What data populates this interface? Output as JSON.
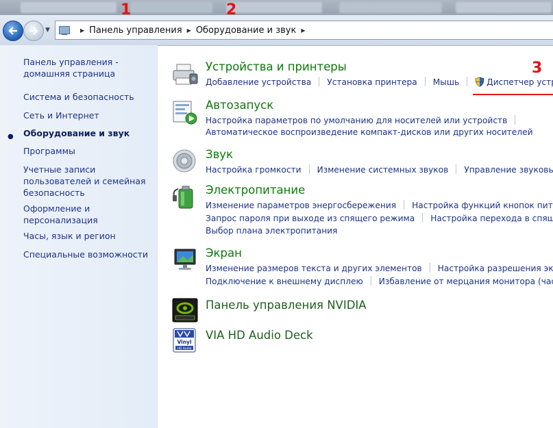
{
  "annotations": [
    "1",
    "2",
    "3"
  ],
  "address_bar": {
    "crumbs": [
      "Панель управления",
      "Оборудование и звук"
    ]
  },
  "sidebar": {
    "home": "Панель управления - домашняя страница",
    "items": [
      "Система и безопасность",
      "Сеть и Интернет",
      "Оборудование и звук",
      "Программы",
      "Учетные записи пользователей и семейная безопасность",
      "Оформление и персонализация",
      "Часы, язык и регион",
      "Специальные возможности"
    ],
    "active_index": 2
  },
  "categories": {
    "devices": {
      "title": "Устройства и принтеры",
      "links": [
        "Добавление устройства",
        "Установка принтера",
        "Мышь",
        "Диспетчер устр"
      ],
      "icon": "printer-icon"
    },
    "autoplay": {
      "title": "Автозапуск",
      "links_row1": [
        "Настройка параметров по умолчанию для носителей или устройств"
      ],
      "links_row2": [
        "Автоматическое воспроизведение компакт-дисков или других носителей"
      ],
      "icon": "autoplay-icon"
    },
    "sound": {
      "title": "Звук",
      "links": [
        "Настройка громкости",
        "Изменение системных звуков",
        "Управление звуковы"
      ],
      "icon": "speaker-icon"
    },
    "power": {
      "title": "Электропитание",
      "links_row1": [
        "Изменение параметров энергосбережения",
        "Настройка функций кнопок пита"
      ],
      "links_row2": [
        "Запрос пароля при выходе из спящего режима",
        "Настройка перехода в спящ"
      ],
      "links_row3": [
        "Выбор плана электропитания"
      ],
      "icon": "battery-icon"
    },
    "display": {
      "title": "Экран",
      "links_row1": [
        "Изменение размеров текста и других элементов",
        "Настройка разрешения экра"
      ],
      "links_row2": [
        "Подключение к внешнему дисплею",
        "Избавление от мерцания монитора (час"
      ],
      "icon": "monitor-icon"
    },
    "nvidia": {
      "title": "Панель управления NVIDIA",
      "icon": "nvidia-icon"
    },
    "via": {
      "title": "VIA HD Audio Deck",
      "icon": "via-audio-icon",
      "logo_text": [
        "Vinyl",
        "HD Audio"
      ]
    }
  },
  "colors": {
    "title_green": "#0b7a0b",
    "link_blue": "#1e3287",
    "annotation_red": "#e41414"
  }
}
